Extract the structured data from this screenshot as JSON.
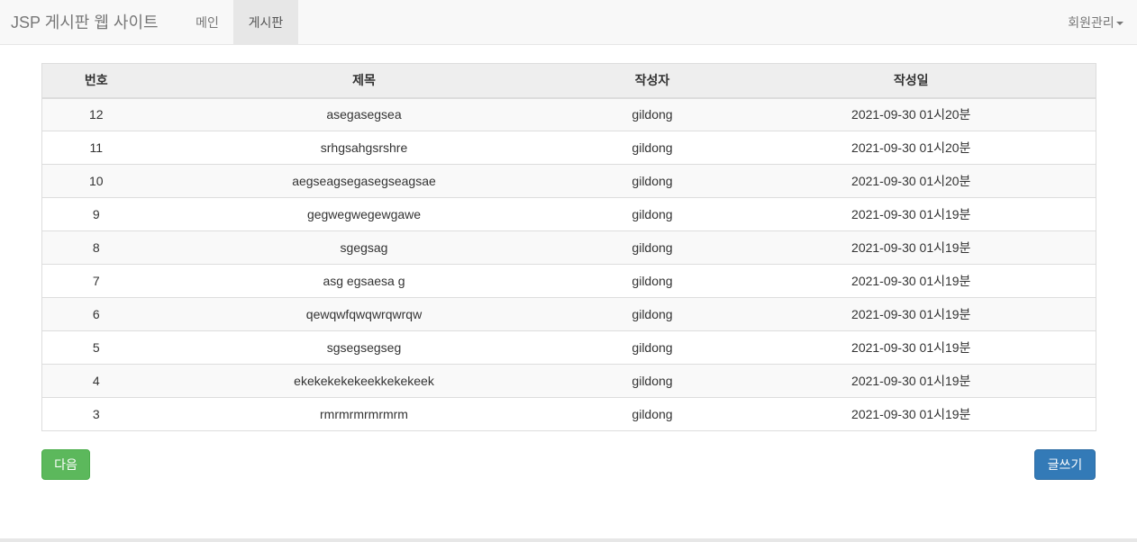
{
  "navbar": {
    "brand": "JSP 게시판 웹 사이트",
    "items": [
      {
        "label": "메인"
      },
      {
        "label": "게시판",
        "active": true
      }
    ],
    "member_menu": "회원관리"
  },
  "table": {
    "headers": [
      "번호",
      "제목",
      "작성자",
      "작성일"
    ],
    "rows": [
      [
        "12",
        "asegasegsea",
        "gildong",
        "2021-09-30 01시20분"
      ],
      [
        "11",
        "srhgsahgsrshre",
        "gildong",
        "2021-09-30 01시20분"
      ],
      [
        "10",
        "aegseagsegasegseagsae",
        "gildong",
        "2021-09-30 01시20분"
      ],
      [
        "9",
        "gegwegwegewgawe",
        "gildong",
        "2021-09-30 01시19분"
      ],
      [
        "8",
        "sgegsag",
        "gildong",
        "2021-09-30 01시19분"
      ],
      [
        "7",
        "asg egsaesa g",
        "gildong",
        "2021-09-30 01시19분"
      ],
      [
        "6",
        "qewqwfqwqwrqwrqw",
        "gildong",
        "2021-09-30 01시19분"
      ],
      [
        "5",
        "sgsegsegseg",
        "gildong",
        "2021-09-30 01시19분"
      ],
      [
        "4",
        "ekekekekekeekkekekeek",
        "gildong",
        "2021-09-30 01시19분"
      ],
      [
        "3",
        "rmrmrmrmrmrm",
        "gildong",
        "2021-09-30 01시19분"
      ]
    ]
  },
  "buttons": {
    "next": "다음",
    "write": "글쓰기"
  },
  "colors": {
    "next_button": "#5cb85c",
    "write_button": "#337ab7",
    "navbar_bg": "#f8f8f8",
    "active_tab_bg": "#e7e7e7"
  }
}
